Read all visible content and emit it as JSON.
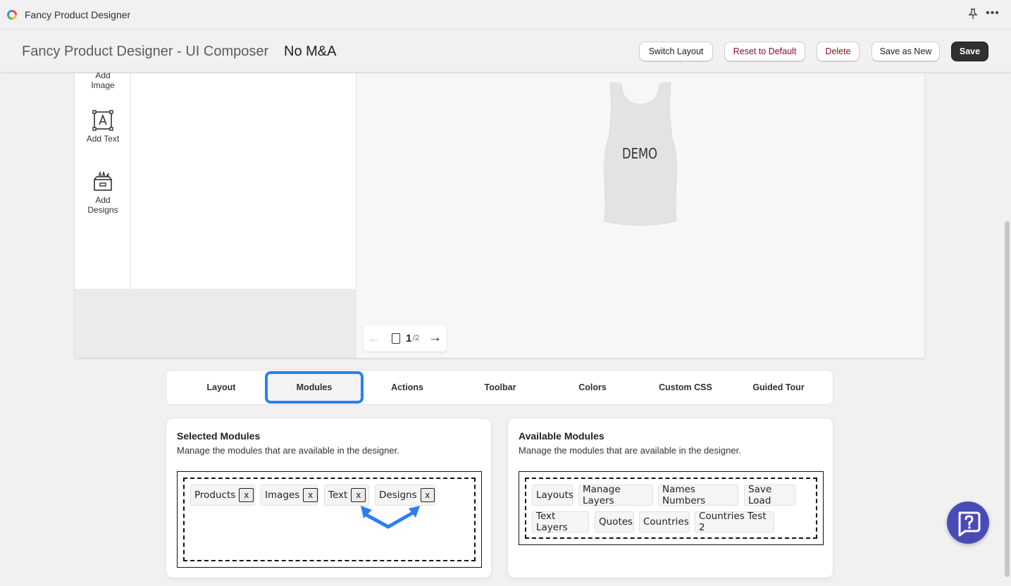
{
  "app": {
    "title": "Fancy Product Designer"
  },
  "header": {
    "title": "Fancy Product Designer - UI Composer",
    "subtitle": "No M&A",
    "buttons": {
      "switch_layout": "Switch Layout",
      "reset": "Reset to Default",
      "delete": "Delete",
      "save_as_new": "Save as New",
      "save": "Save"
    }
  },
  "designer": {
    "nav": [
      {
        "label": "Add\nImage",
        "icon": "image-icon"
      },
      {
        "label": "Add Text",
        "icon": "text-icon"
      },
      {
        "label": "Add\nDesigns",
        "icon": "designs-icon"
      }
    ],
    "product_text": "DEMO",
    "pager": {
      "current": "1",
      "total": "/2"
    }
  },
  "tabs": [
    "Layout",
    "Modules",
    "Actions",
    "Toolbar",
    "Colors",
    "Custom CSS",
    "Guided Tour"
  ],
  "active_tab": "Modules",
  "selected_modules": {
    "title": "Selected Modules",
    "description": "Manage the modules that are available in the designer.",
    "items": [
      "Products",
      "Images",
      "Text",
      "Designs"
    ],
    "remove_label": "x"
  },
  "available_modules": {
    "title": "Available Modules",
    "description": "Manage the modules that are available in the designer.",
    "items": [
      "Layouts",
      "Manage Layers",
      "Names Numbers",
      "Save Load",
      "Text Layers",
      "Quotes",
      "Countries",
      "Countries Test 2"
    ]
  },
  "colors": {
    "accent_highlight": "#2b7ff0",
    "primary_button": "#303030",
    "danger_text": "#8e0b21",
    "help_bubble": "#4a4ab7"
  }
}
